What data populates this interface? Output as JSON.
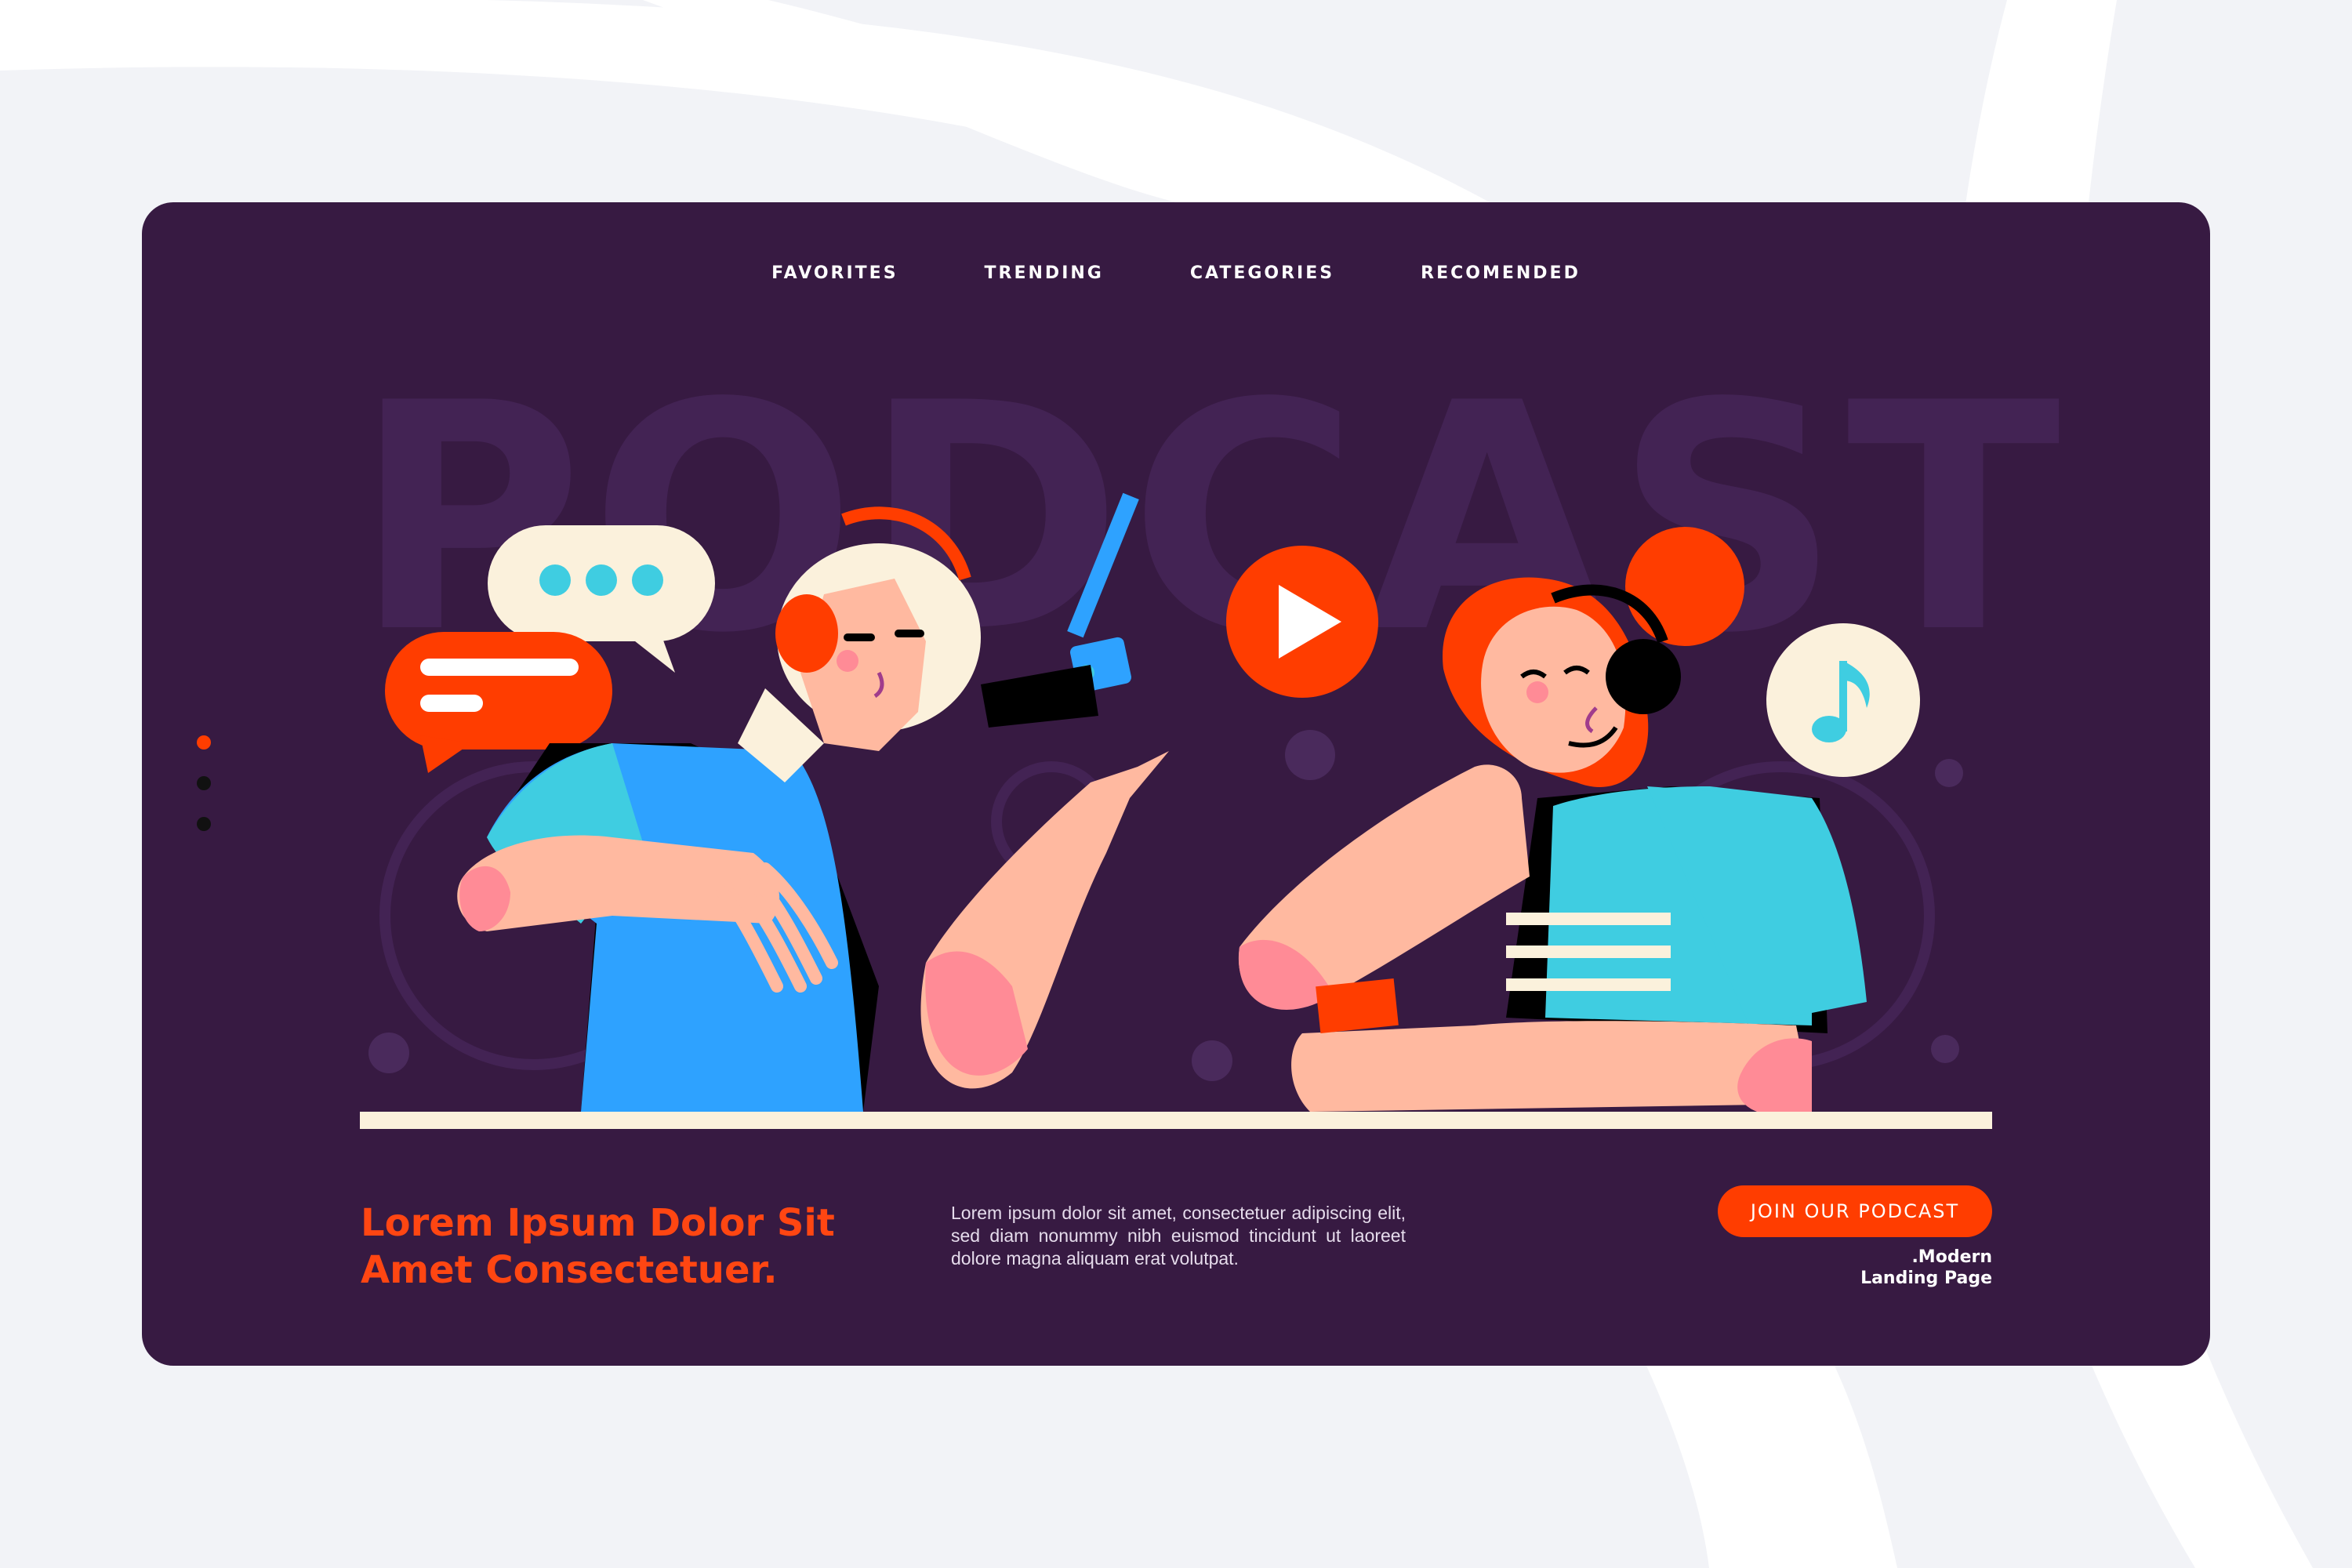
{
  "nav": {
    "items": [
      {
        "label": "FAVORITES"
      },
      {
        "label": "TRENDING"
      },
      {
        "label": "CATEGORIES"
      },
      {
        "label": "RECOMENDED"
      }
    ]
  },
  "hero": {
    "watermark": "PODCAST",
    "headline_line1": "Lorem Ipsum Dolor Sit",
    "headline_line2": "Amet Consectetuer.",
    "description": "Lorem ipsum dolor sit amet, consectetuer adipiscing elit, sed diam nonummy nibh euismod tincidunt ut laoreet dolore magna aliquam erat volutpat.",
    "cta_label": "JOIN OUR PODCAST",
    "tagline_line1": ".Modern",
    "tagline_line2": "Landing Page"
  },
  "slider": {
    "count": 3,
    "active_index": 0
  },
  "icons": [
    "chat-bubble-icon",
    "message-lines-icon",
    "microphone-icon",
    "play-icon",
    "music-note-icon"
  ],
  "colors": {
    "background": "#f2f3f7",
    "card": "#371a42",
    "accent": "#ff3d00",
    "cream": "#fbf1dc",
    "cyan": "#3fcde1",
    "blue": "#2ea2ff",
    "skin": "#ffb9a0"
  }
}
